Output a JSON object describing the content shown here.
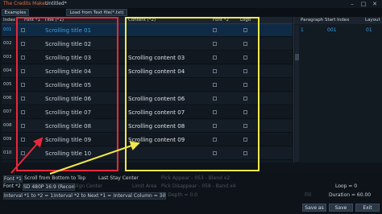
{
  "titlebar": {
    "app_name": "The Credits Maker",
    "file_name": "Untitled*",
    "minimize": "–",
    "maximize": "□",
    "close": "✕"
  },
  "toolbar": {
    "examples": "Examples",
    "load_text": "Load from Text file(*.txt)"
  },
  "grid": {
    "headers": {
      "index": "Index",
      "font1": "Font *1",
      "title": "Title (*1)",
      "content": "Content (*2)",
      "font2": "Font *2",
      "logo": "Logo"
    },
    "rows": [
      {
        "index": "001",
        "title": "Scrolling title 01",
        "content": ""
      },
      {
        "index": "002",
        "title": "Scrolling title 02",
        "content": ""
      },
      {
        "index": "003",
        "title": "Scrolling title 03",
        "content": "Scrolling content 03"
      },
      {
        "index": "004",
        "title": "Scrolling title 04",
        "content": "Scrolling content 04"
      },
      {
        "index": "005",
        "title": "Scrolling title 05",
        "content": ""
      },
      {
        "index": "006",
        "title": "Scrolling title 06",
        "content": "Scrolling content 06"
      },
      {
        "index": "007",
        "title": "Scrolling title 07",
        "content": "Scrolling content 07"
      },
      {
        "index": "008",
        "title": "Scrolling title 08",
        "content": "Scrolling content 08"
      },
      {
        "index": "009",
        "title": "Scrolling title 09",
        "content": "Scrolling content 09"
      },
      {
        "index": "010",
        "title": "Scrolling title 10",
        "content": ""
      }
    ]
  },
  "paragraph_panel": {
    "headers": {
      "paragraph": "Paragraph",
      "start_index": "Start Index",
      "layout": "Layout"
    },
    "row": {
      "paragraph": "1",
      "start_index": "001",
      "layout": "01"
    }
  },
  "settings": {
    "font1_label": "Font *1",
    "scroll_mode": "Scroll from Bottom to Top",
    "last_stay": "Last Stay Center",
    "pick_appear": "Pick Appear - 053 - Blend x2",
    "font2_label": "Font *2",
    "format": "SD 480P 16:9 (Recon",
    "align": "Align Center",
    "limit_area": "Limit Area",
    "pick_disappear": "Pick Disappear - 058 - Band x4",
    "loop": "Loop = 0",
    "interval_1_2": "Interval *1 to *2 = 15",
    "interval_2_1": "Interval *2 to Next *1 = 50",
    "interval_column": "Interval Column = 30",
    "depth_3d": "3D Depth = 0.0",
    "fill": "Fill",
    "duration": "Duration = 60.00"
  },
  "buttons": {
    "save_as": "Save as",
    "save": "Save",
    "exit": "Exit"
  },
  "colors": {
    "accent": "#3aa0e8",
    "highlight_red": "#e8283a",
    "highlight_yellow": "#f2e84a",
    "app_name": "#e26b3a"
  }
}
